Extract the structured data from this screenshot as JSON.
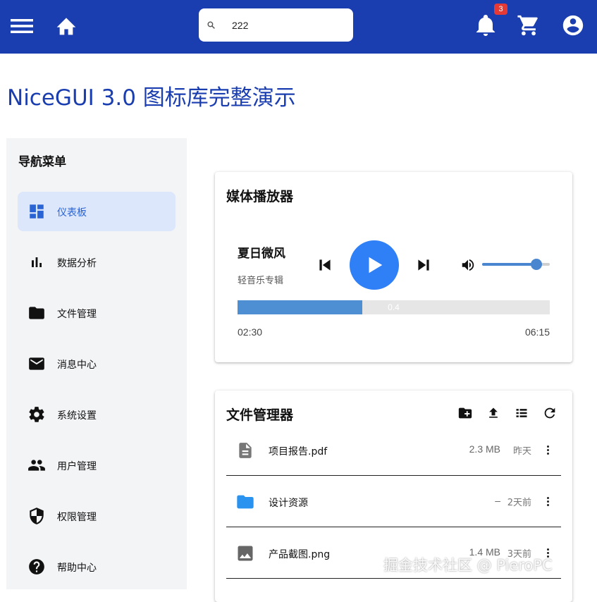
{
  "header": {
    "search_value": "222",
    "notification_count": "3",
    "bg_color": "#1a3eb0",
    "icons": [
      "menu-icon",
      "home-icon",
      "search-icon",
      "bell-icon",
      "cart-icon",
      "account-circle-icon"
    ]
  },
  "page_title": "NiceGUI 3.0 图标库完整演示",
  "sidebar": {
    "title": "导航菜单",
    "items": [
      {
        "label": "仪表板",
        "icon": "dashboard-icon",
        "active": true
      },
      {
        "label": "数据分析",
        "icon": "bar-chart-icon"
      },
      {
        "label": "文件管理",
        "icon": "folder-icon"
      },
      {
        "label": "消息中心",
        "icon": "mail-icon"
      },
      {
        "label": "系统设置",
        "icon": "gear-icon"
      },
      {
        "label": "用户管理",
        "icon": "people-icon"
      },
      {
        "label": "权限管理",
        "icon": "shield-icon"
      },
      {
        "label": "帮助中心",
        "icon": "help-icon"
      }
    ]
  },
  "media_player": {
    "title": "媒体播放器",
    "song_title": "夏日微风",
    "album": "轻音乐专辑",
    "progress_value": 0.4,
    "progress_label": "0.4",
    "volume": 0.8,
    "current_time": "02:30",
    "total_time": "06:15",
    "accent": "#2f7ff6"
  },
  "file_manager": {
    "title": "文件管理器",
    "toolbar_icons": [
      "create-folder-icon",
      "upload-icon",
      "list-view-icon",
      "refresh-icon"
    ],
    "files": [
      {
        "name": "项目报告.pdf",
        "size": "2.3 MB",
        "date": "昨天",
        "icon": "document-icon"
      },
      {
        "name": "设计资源",
        "size": "–",
        "date": "2天前",
        "icon": "folder-icon"
      },
      {
        "name": "产品截图.png",
        "size": "1.4 MB",
        "date": "3天前",
        "icon": "image-icon"
      }
    ]
  },
  "watermark": "掘金技术社区 @ PieroPC"
}
